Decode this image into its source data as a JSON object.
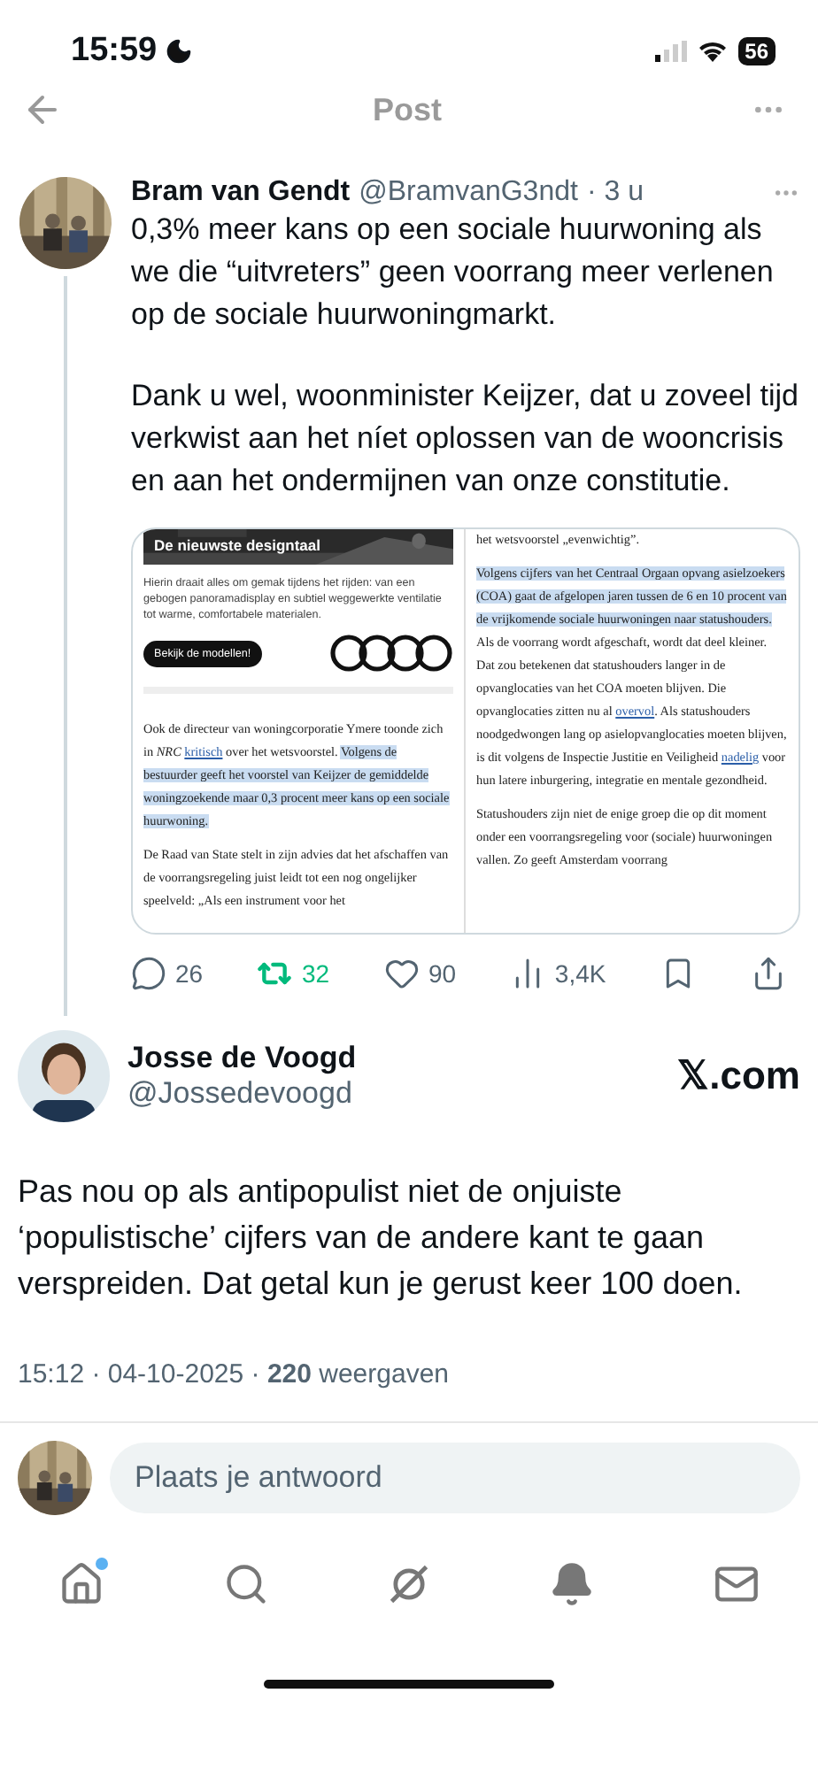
{
  "status_bar": {
    "time": "15:59",
    "battery": "56"
  },
  "header": {
    "title": "Post"
  },
  "quoted_tweet": {
    "name": "Bram van Gendt",
    "handle": "@BramvanG3ndt",
    "age": "· 3 u",
    "paragraphs": [
      "0,3% meer kans op een sociale huurwoning als we die “uitvreters” geen voorrang meer verlenen op de sociale huurwoningmarkt.",
      "Dank u wel, woonminister Keijzer, dat u zoveel tijd verkwist aan het níet oplossen van de wooncrisis en aan het ondermijnen van onze constitutie."
    ],
    "screenshot": {
      "ad": {
        "title": "De nieuwste designtaal",
        "text": "Hierin draait alles om gemak tijdens het rijden: van een gebogen panoramadisplay en subtiel weggewerkte ventilatie tot warme, comfortabele materialen.",
        "button": "Bekijk de modellen!"
      },
      "left_paragraphs": [
        [
          {
            "kind": "text",
            "text": "Ook de directeur van woningcorporatie Ymere toonde zich in *NRC* "
          },
          {
            "kind": "link",
            "text": "kritisch"
          },
          {
            "kind": "text",
            "text": " over het wetsvoorstel. "
          },
          {
            "kind": "selected",
            "text": "Volgens de bestuurder geeft het voorstel van Keijzer de gemiddelde woningzoekende maar 0,3 procent meer kans op een sociale huurwoning."
          }
        ],
        [
          {
            "kind": "text",
            "text": "De Raad van State stelt in zijn advies dat het afschaffen van de voorrangsregeling juist leidt tot een nog ongelijker speelveld: „Als een instrument voor het"
          }
        ]
      ],
      "right_paragraphs": [
        [
          {
            "kind": "text",
            "text": "het wetsvoorstel „evenwichtig”."
          }
        ],
        [
          {
            "kind": "selected",
            "text": "Volgens cijfers van het Centraal Orgaan opvang asielzoekers (COA) gaat de afgelopen jaren tussen de 6 en 10 procent van de vrijkomende sociale huurwoningen naar statushouders."
          },
          {
            "kind": "text",
            "text": " Als de voorrang wordt afgeschaft, wordt dat deel kleiner. Dat zou betekenen dat statushouders langer in de opvanglocaties van het COA moeten blijven. Die opvanglocaties zitten nu al "
          },
          {
            "kind": "link",
            "text": "overvol"
          },
          {
            "kind": "text",
            "text": ". Als statushouders noodgedwongen lang op asielopvanglocaties moeten blijven, is dit volgens de Inspectie Justitie en Veiligheid "
          },
          {
            "kind": "link",
            "text": "nadelig"
          },
          {
            "kind": "text",
            "text": " voor hun latere inburgering, integratie en mentale gezondheid."
          }
        ],
        [
          {
            "kind": "text",
            "text": "Statushouders zijn niet de enige groep die op dit moment onder een voorrangsregeling voor (sociale) huurwoningen vallen. Zo geeft Amsterdam voorrang"
          }
        ]
      ]
    },
    "actions": [
      {
        "kind": "reply",
        "count": "26",
        "active": false
      },
      {
        "kind": "repost",
        "count": "32",
        "active": true
      },
      {
        "kind": "like",
        "count": "90",
        "active": false
      },
      {
        "kind": "views",
        "count": "3,4K",
        "active": false
      },
      {
        "kind": "bookmark",
        "active": false
      },
      {
        "kind": "share",
        "active": false
      }
    ]
  },
  "reply_tweet": {
    "name": "Josse de Voogd",
    "handle": "@Jossedevoogd",
    "source": "𝕏.com",
    "text": "Pas nou op als antipopulist niet de onjuiste ‘populistische’ cijfers van de andere kant te gaan verspreiden. Dat getal kun je gerust keer 100 doen.",
    "meta": "15:12 · 04-10-2025 · **220** weergaven"
  },
  "reply_bar": {
    "placeholder": "Plaats je antwoord"
  },
  "tabs": [
    {
      "kind": "home",
      "selected": false,
      "badge": true
    },
    {
      "kind": "search",
      "selected": false,
      "badge": false
    },
    {
      "kind": "grok",
      "selected": false,
      "badge": false
    },
    {
      "kind": "notifications",
      "selected": false,
      "badge": false
    },
    {
      "kind": "messages",
      "selected": false,
      "badge": false
    }
  ]
}
